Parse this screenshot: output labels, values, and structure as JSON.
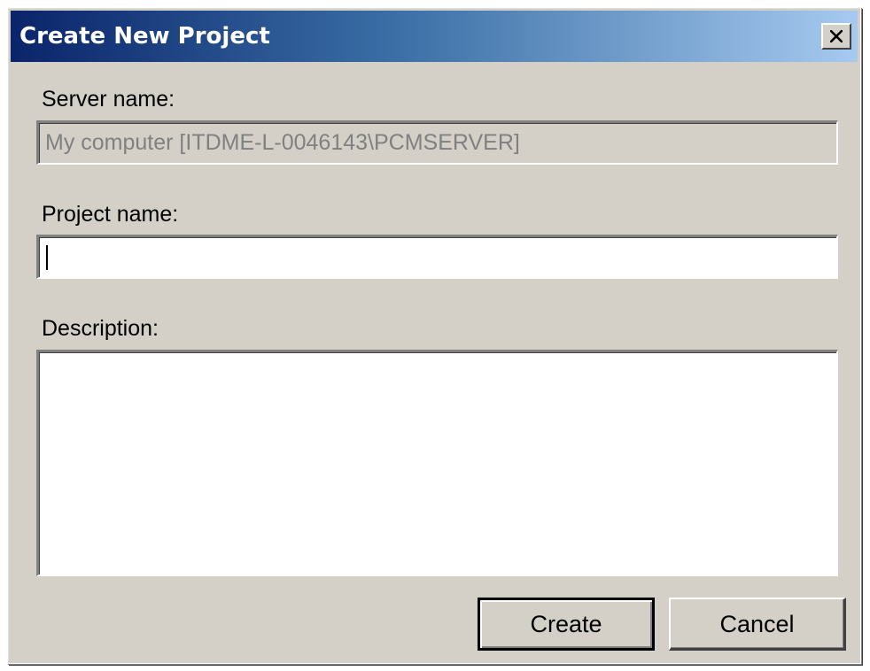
{
  "dialog": {
    "title": "Create New Project",
    "close_icon": "close-x-icon"
  },
  "server": {
    "label": "Server name:",
    "value": "My computer [ITDME-L-0046143\\PCMSERVER]"
  },
  "project": {
    "label": "Project name:",
    "value": ""
  },
  "description": {
    "label": "Description:",
    "value": ""
  },
  "buttons": {
    "create_label": "Create",
    "cancel_label": "Cancel"
  },
  "colors": {
    "title_gradient_start": "#0a246a",
    "title_gradient_end": "#a6caf0",
    "dialog_face": "#d4d0c8",
    "disabled_text": "#808080"
  }
}
